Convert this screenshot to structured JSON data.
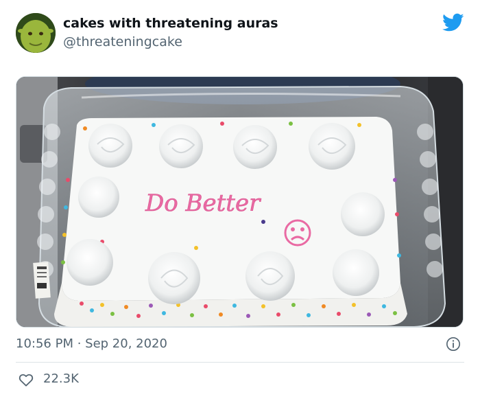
{
  "author": {
    "display_name": "cakes with threatening auras",
    "handle": "@threateningcake",
    "avatar_icon": "shrek-avatar"
  },
  "brand": {
    "logo_icon": "twitter-bird-icon",
    "accent_color": "#1d9bf0"
  },
  "media": {
    "cake_text": "Do Better",
    "cake_face": "sad-face",
    "frosting_color": "#e96aa3",
    "label_text": "WEIGHT"
  },
  "meta": {
    "timestamp": "10:56 PM · Sep 20, 2020"
  },
  "engagement": {
    "like_count": "22.3K",
    "like_icon": "heart-outline-icon",
    "info_icon": "info-icon"
  }
}
